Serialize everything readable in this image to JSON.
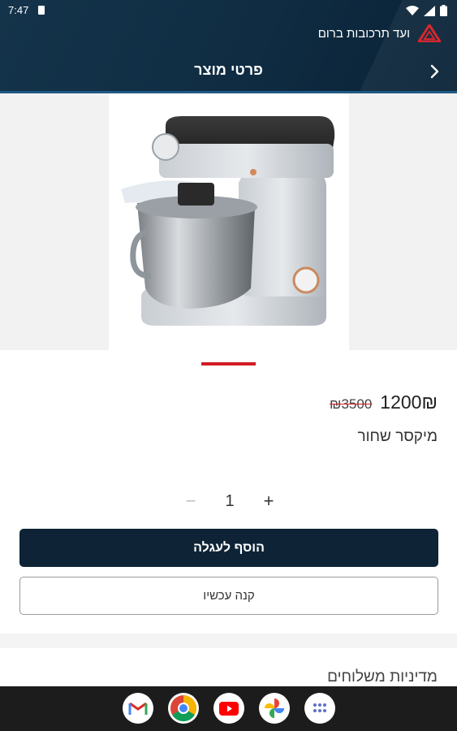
{
  "status_bar": {
    "time": "7:47"
  },
  "header": {
    "brand_name": "ועד תרכובות ברום",
    "title": "פרטי מוצר"
  },
  "product": {
    "image_alt": "Stand mixer",
    "price": "1200",
    "currency": "₪",
    "old_price": "₪3500",
    "name": "מיקסר שחור",
    "quantity": "1",
    "gallery_page": 1
  },
  "actions": {
    "add_to_cart": "הוסף לעגלה",
    "buy_now": "קנה עכשיו",
    "qty_minus": "−",
    "qty_plus": "+"
  },
  "sections": {
    "shipping_policy": "מדיניות משלוחים"
  },
  "dock": {
    "apps": [
      "gmail-icon",
      "chrome-icon",
      "youtube-icon",
      "photos-icon",
      "app-drawer-icon"
    ]
  },
  "colors": {
    "header_bg": "#0f2c42",
    "accent_red": "#d31c24",
    "primary_button": "#0e2436"
  }
}
